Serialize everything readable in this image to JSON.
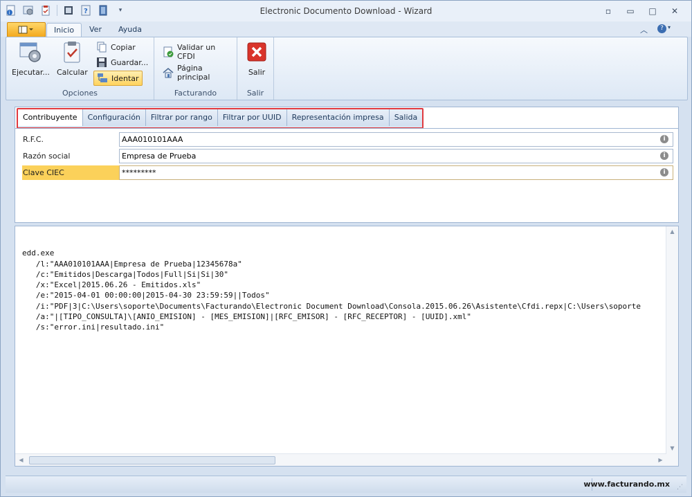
{
  "window": {
    "title": "Electronic Documento Download - Wizard",
    "controls": {
      "restore_icon": "▫",
      "minimize": "▭",
      "maximize": "□",
      "close": "✕"
    }
  },
  "ribbon": {
    "tabs": [
      {
        "label": "Inicio",
        "active": true
      },
      {
        "label": "Ver",
        "active": false
      },
      {
        "label": "Ayuda",
        "active": false
      }
    ],
    "groups": {
      "opciones": {
        "label": "Opciones",
        "ejecutar": "Ejecutar...",
        "calcular": "Calcular",
        "copiar": "Copiar",
        "guardar": "Guardar...",
        "identar": "Identar"
      },
      "facturando": {
        "label": "Facturando",
        "validar": "Validar un CFDI",
        "pagina": "Página principal"
      },
      "salir": {
        "label": "Salir",
        "salir": "Salir"
      }
    }
  },
  "form": {
    "tabs": [
      "Contribuyente",
      "Configuración",
      "Filtrar por rango",
      "Filtrar por UUID",
      "Representación impresa",
      "Salida"
    ],
    "active_tab": "Contribuyente",
    "fields": {
      "rfc": {
        "label": "R.F.C.",
        "value": "AAA010101AAA"
      },
      "razon": {
        "label": "Razón social",
        "value": "Empresa de Prueba"
      },
      "clave": {
        "label": "Clave CIEC",
        "value": "*********"
      }
    }
  },
  "output": {
    "lines": [
      "edd.exe",
      "   /l:\"AAA010101AAA|Empresa de Prueba|12345678a\"",
      "   /c:\"Emitidos|Descarga|Todos|Full|Si|Si|30\"",
      "   /x:\"Excel|2015.06.26 - Emitidos.xls\"",
      "   /e:\"2015-04-01 00:00:00|2015-04-30 23:59:59||Todos\"",
      "   /i:\"PDF|3|C:\\Users\\soporte\\Documents\\Facturando\\Electronic Document Download\\Consola.2015.06.26\\Asistente\\Cfdi.repx|C:\\Users\\soporte",
      "   /a:\"|[TIPO_CONSULTA]\\[ANIO_EMISION] - [MES_EMISION]|[RFC_EMISOR] - [RFC_RECEPTOR] - [UUID].xml\"",
      "   /s:\"error.ini|resultado.ini\""
    ]
  },
  "status": {
    "site": "www.facturando.mx"
  },
  "colors": {
    "accent_orange": "#f3a91e",
    "highlight_yellow": "#fbd15a",
    "tab_outline": "#e0393e",
    "close_red": "#d9342b"
  }
}
